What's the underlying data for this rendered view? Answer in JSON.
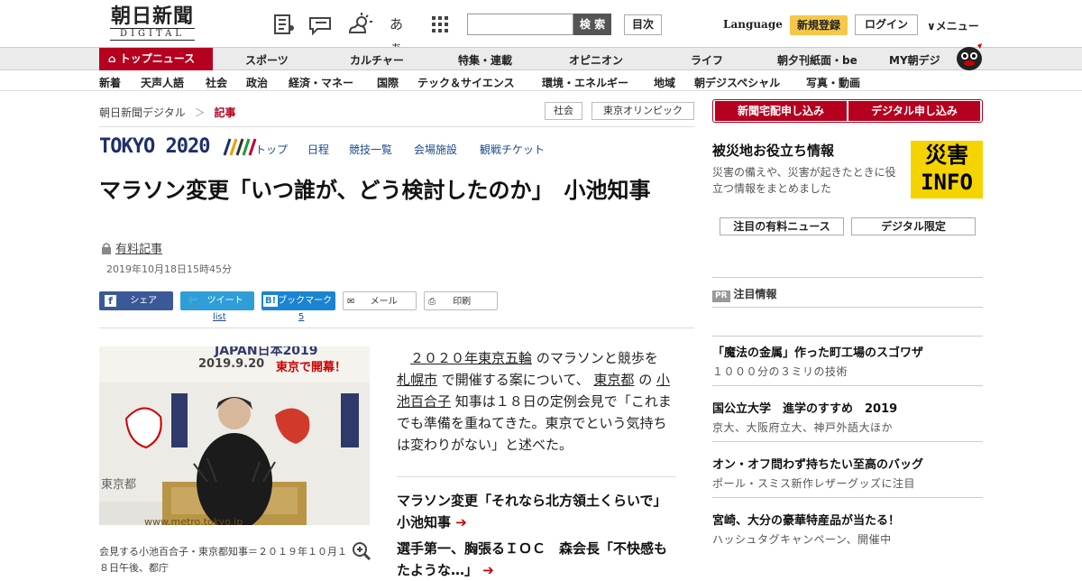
{
  "logo": {
    "jp": "朝日新聞",
    "en": "DIGITAL"
  },
  "header": {
    "search_button": "検 索",
    "index_button": "目次",
    "language": "Language",
    "signup": "新規登録",
    "login": "ログイン",
    "menu": "メニュー",
    "font_size_icon_text": "あぁ"
  },
  "nav_main": {
    "home": "トップニュース",
    "items": [
      "スポーツ",
      "カルチャー",
      "特集・連載",
      "オピニオン",
      "ライフ",
      "朝夕刊紙面・be",
      "MY朝デジ"
    ]
  },
  "nav_sub": {
    "items": [
      "新着",
      "天声人語",
      "社会",
      "政治",
      "経済・マネー",
      "国際",
      "テック＆サイエンス",
      "環境・エネルギー",
      "地域",
      "朝デジスペシャル",
      "写真・動画"
    ]
  },
  "breadcrumb": {
    "root": "朝日新聞デジタル",
    "sep": "＞",
    "current": "記事"
  },
  "tags": [
    "社会",
    "東京オリンピック"
  ],
  "olympic": {
    "logo": "TOKYO 2020",
    "nav": [
      "トップ",
      "日程",
      "競技一覧",
      "会場施設",
      "観戦チケット"
    ]
  },
  "article": {
    "title": "マラソン変更「いつ誰が、どう検討したのか」　小池知事",
    "paid_label": "有料記事",
    "date": "2019年10月18日15時45分",
    "share": {
      "facebook": "シェア",
      "twitter": "ツイート",
      "hatena": "ブックマーク",
      "mail": "メール",
      "print": "印刷"
    },
    "twitter_sub": "list",
    "hatena_sub": "5",
    "photo_banner": "JAPAN日本2019",
    "photo_date": "2019.9.20",
    "photo_text": "東京で開幕！",
    "photo_sign": "東京都",
    "photo_url": "www.metro.tokyo.jp",
    "caption": "会見する小池百合子・東京都知事＝２０１９年１０月１８日午後、都庁",
    "body": {
      "p1": "２０２０年東京五輪",
      "p2": "のマラソンと競歩を",
      "p3": "札幌市",
      "p4": "で開催する案について、",
      "p5": "東京都",
      "p6": "の",
      "p7": "小池百合子",
      "p8": "知事は１８日の定例会見で「これまでも準備を重ねてきた。東京でという気持ちは変わりがない」と述べた。"
    },
    "related": [
      "マラソン変更「それなら北方領土くらいで」　小池知事",
      "選手第一、胸張るＩＯＣ　森会長「不快感もたような…」"
    ]
  },
  "sidebar": {
    "delivery": "新聞宅配申し込み",
    "digital": "デジタル申し込み",
    "disaster_title": "被災地お役立ち情報",
    "disaster_desc": "災害の備えや、災害が起きたときに役立つ情報をまとめました",
    "disaster_badge_top": "災害",
    "disaster_badge_bottom": "INFO",
    "paid_news": "注目の有料ニュース",
    "digital_only": "デジタル限定",
    "pr_badge": "PR",
    "pr_title": "注目情報",
    "ads": [
      {
        "title": "「魔法の金属」作った町工場のスゴワザ",
        "sub": "１０００分の３ミリの技術"
      },
      {
        "title": "国公立大学　進学のすすめ　2019",
        "sub": "京大、大阪府立大、神戸外語大ほか"
      },
      {
        "title": "オン・オフ問わず持ちたい至高のバッグ",
        "sub": "ポール・スミス新作レザーグッズに注目"
      },
      {
        "title": "宮崎、大分の豪華特産品が当たる！",
        "sub": "ハッシュタグキャンペーン、開催中"
      }
    ]
  },
  "colors": {
    "brand_red": "#b5001f",
    "signup_yellow": "#f5c84a",
    "olympic_blue": "#1d2f6b",
    "link_blue": "#1d4b8f"
  }
}
